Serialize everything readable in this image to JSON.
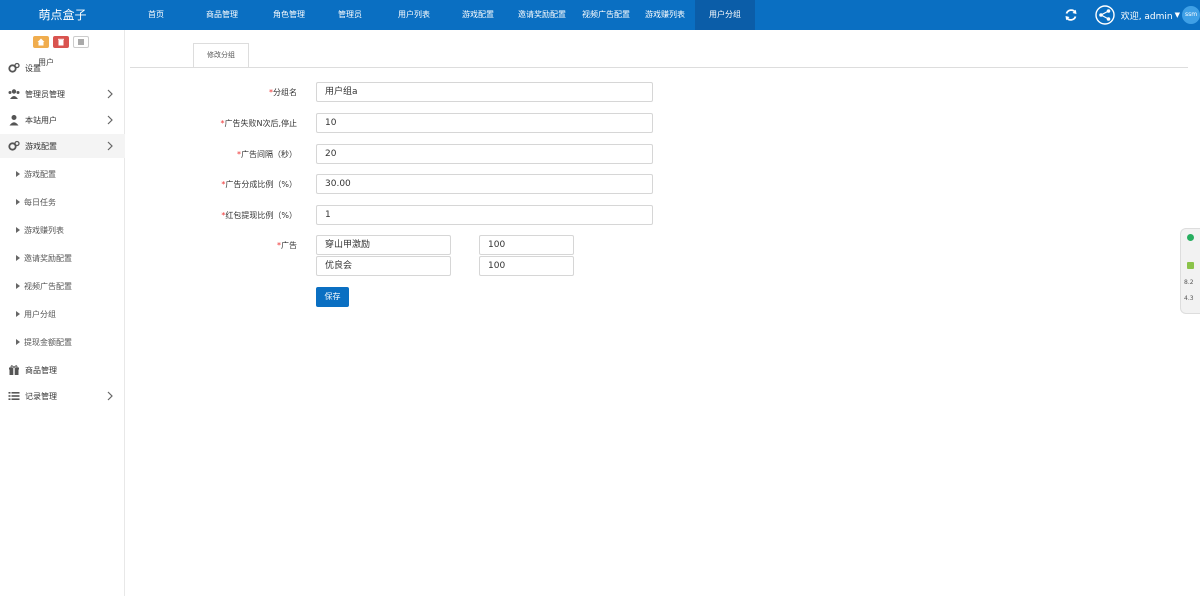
{
  "app": {
    "brand": "萌点盒子"
  },
  "nav": [
    {
      "label": "首页",
      "active": false
    },
    {
      "label": "商品管理",
      "active": false
    },
    {
      "label": "角色管理",
      "active": false
    },
    {
      "label": "管理员",
      "active": false
    },
    {
      "label": "用户列表",
      "active": false
    },
    {
      "label": "游戏配置",
      "active": false
    },
    {
      "label": "邀请奖励配置",
      "active": false
    },
    {
      "label": "视频广告配置",
      "active": false
    },
    {
      "label": "游戏赚列表",
      "active": false
    },
    {
      "label": "用户分组",
      "active": true
    }
  ],
  "topright": {
    "welcome": "欢迎, admin",
    "avatar": "ssm"
  },
  "sidebar": {
    "items": [
      {
        "label": "设置",
        "icon": "gears-icon"
      },
      {
        "label": "管理员管理",
        "icon": "users-icon"
      },
      {
        "label": "本站用户",
        "icon": "user-icon"
      },
      {
        "label": "游戏配置",
        "icon": "gears-icon"
      }
    ],
    "subitems": [
      "游戏配置",
      "每日任务",
      "游戏赚列表",
      "邀请奖励配置",
      "视频广告配置",
      "用户分组",
      "提现金额配置"
    ],
    "bottom": [
      {
        "label": "商品管理",
        "icon": "gift-icon"
      },
      {
        "label": "记录管理",
        "icon": "list-icon"
      }
    ]
  },
  "tabs": {
    "ghost_label": "用户",
    "active_tab": "修改分组"
  },
  "form": {
    "fields": [
      {
        "label": "分组名",
        "value": "用户组a"
      },
      {
        "label": "广告失败N次后,停止",
        "value": "10"
      },
      {
        "label": "广告间隔（秒）",
        "value": "20"
      },
      {
        "label": "广告分成比例（%）",
        "value": "30.00"
      },
      {
        "label": "红包提现比例（%）",
        "value": "1"
      }
    ],
    "ad_label": "广告",
    "ads": [
      {
        "name": "穿山甲激励",
        "value": "100"
      },
      {
        "name": "优良会",
        "value": "100"
      }
    ],
    "save_label": "保存"
  },
  "floatpanel": {
    "n1": "8.2",
    "n2": "4.3"
  },
  "colors": {
    "primary": "#0a6fc2",
    "required": "#e33333"
  }
}
